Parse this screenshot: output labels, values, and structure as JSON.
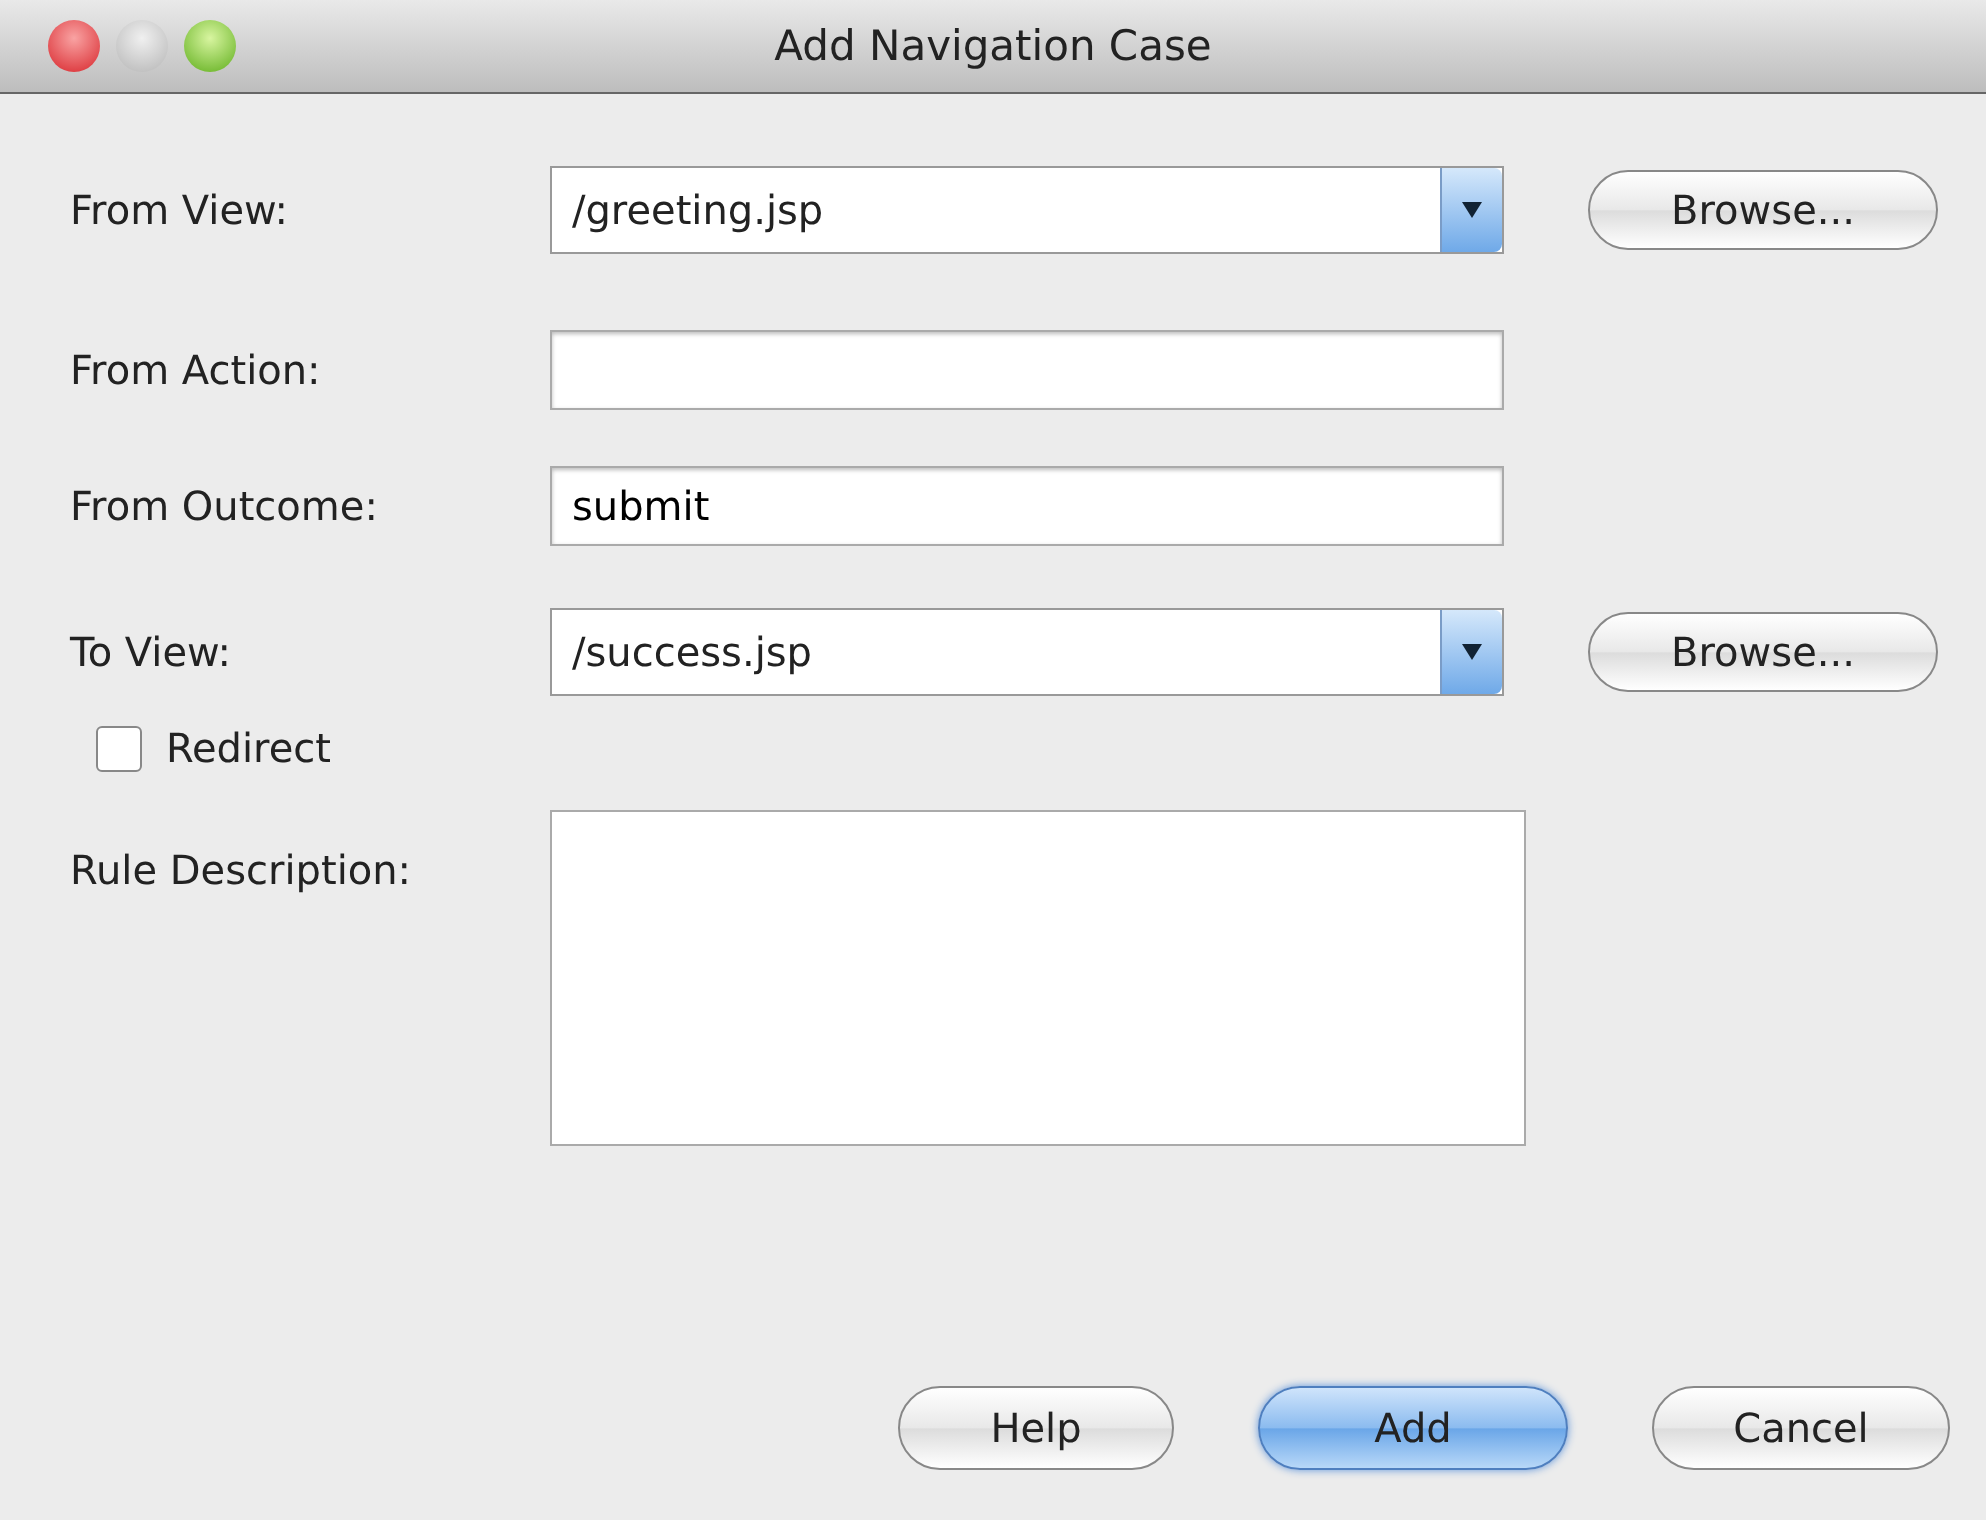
{
  "window": {
    "title": "Add Navigation Case"
  },
  "fields": [
    {
      "kind": "combo",
      "label": "From View:",
      "value": "/greeting.jsp",
      "browse": "Browse..."
    },
    {
      "kind": "text",
      "label": "From Action:"
    },
    {
      "kind": "text",
      "label": "From Outcome:",
      "value": "submit"
    },
    {
      "kind": "combo",
      "label": "To View:",
      "value": "/success.jsp",
      "browse": "Browse..."
    }
  ],
  "redirect": {
    "label": "Redirect",
    "checked": false
  },
  "description": {
    "label": "Rule Description:"
  },
  "buttons": [
    {
      "label": "Help",
      "default": false
    },
    {
      "label": "Add",
      "default": true
    },
    {
      "label": "Cancel",
      "default": false
    }
  ]
}
